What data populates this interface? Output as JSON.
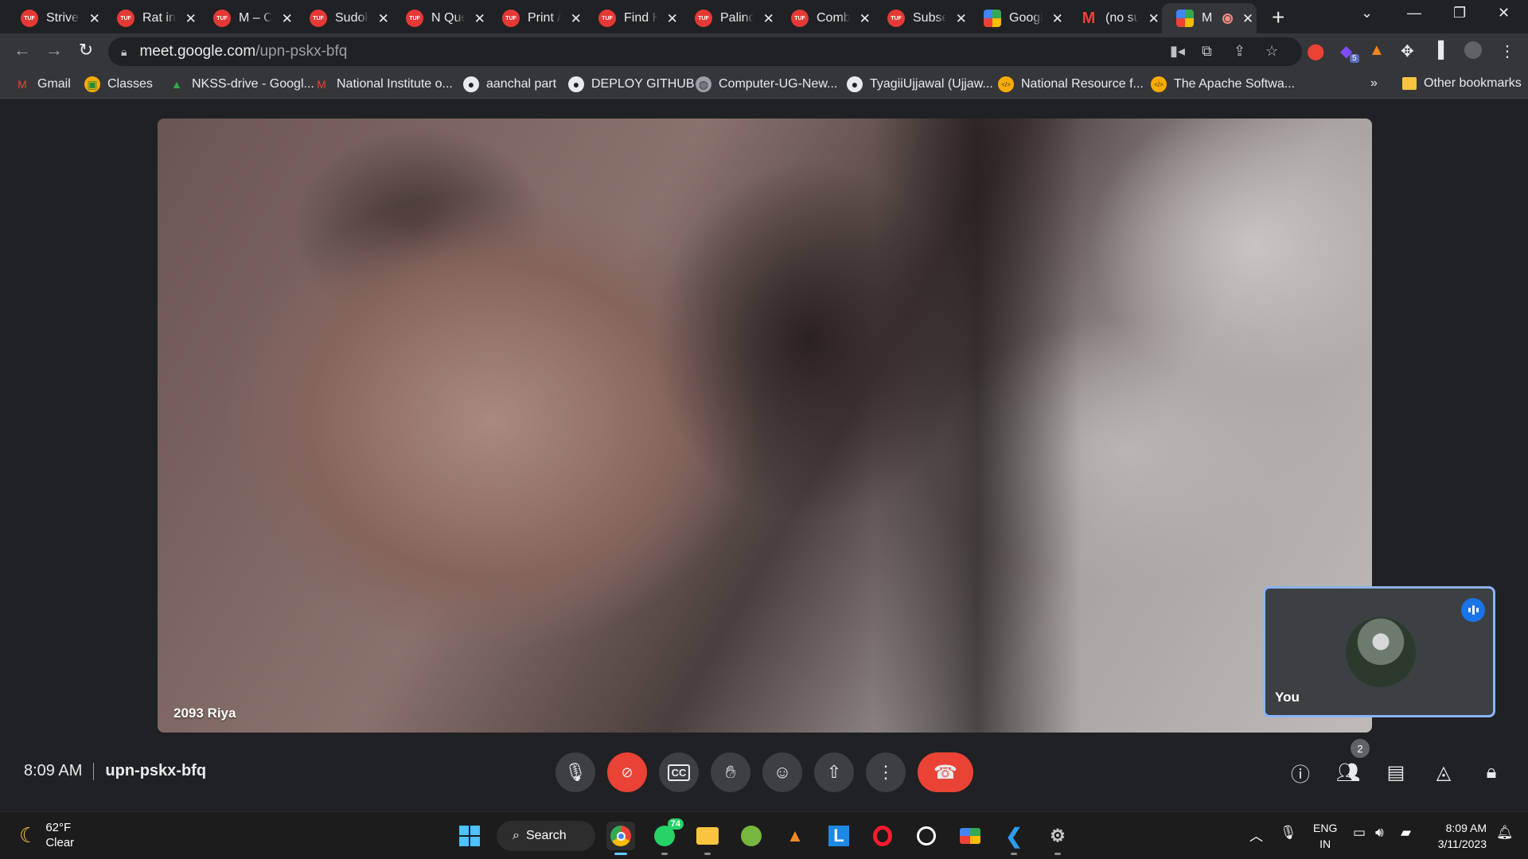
{
  "browser": {
    "tabs": [
      {
        "title": "Striver",
        "favicon": "tuf"
      },
      {
        "title": "Rat in",
        "favicon": "tuf"
      },
      {
        "title": "M – C",
        "favicon": "tuf"
      },
      {
        "title": "Sudok",
        "favicon": "tuf"
      },
      {
        "title": "N Que",
        "favicon": "tuf"
      },
      {
        "title": "Print /",
        "favicon": "tuf"
      },
      {
        "title": "Find K",
        "favicon": "tuf"
      },
      {
        "title": "Palind",
        "favicon": "tuf"
      },
      {
        "title": "Comb",
        "favicon": "tuf"
      },
      {
        "title": "Subse",
        "favicon": "tuf"
      },
      {
        "title": "Googl",
        "favicon": "meet"
      },
      {
        "title": "(no su",
        "favicon": "gmail"
      },
      {
        "title": "M",
        "favicon": "meet",
        "active": true,
        "recording": true
      }
    ],
    "favicon_text": {
      "tuf": "TUF",
      "gmail": "M"
    },
    "url_host": "meet.google.com",
    "url_path": "/upn-pskx-bfq",
    "bookmarks": [
      {
        "label": "Gmail",
        "icon": "gmail-icon"
      },
      {
        "label": "Classes",
        "icon": "classroom-icon"
      },
      {
        "label": "NKSS-drive - Googl...",
        "icon": "drive-icon"
      },
      {
        "label": "National Institute o...",
        "icon": "gmail-icon"
      },
      {
        "label": "aanchal part",
        "icon": "github-icon"
      },
      {
        "label": "DEPLOY GITHUB",
        "icon": "github-icon"
      },
      {
        "label": "Computer-UG-New...",
        "icon": "globe-icon"
      },
      {
        "label": "TyagiiUjjawal (Ujjaw...",
        "icon": "github-icon"
      },
      {
        "label": "National Resource f...",
        "icon": "code-icon"
      },
      {
        "label": "The Apache Softwa...",
        "icon": "code-icon"
      }
    ],
    "more_bookmarks": "»",
    "other_bookmarks": "Other bookmarks",
    "extension_badge": "5"
  },
  "meet": {
    "participant_name": "2093 Riya",
    "self_label": "You",
    "time": "8:09 AM",
    "meeting_code": "upn-pskx-bfq",
    "participant_count": "2"
  },
  "taskbar": {
    "weather_temp": "62°F",
    "weather_desc": "Clear",
    "search_label": "Search",
    "whatsapp_badge": "74",
    "lang_line1": "ENG",
    "lang_line2": "IN",
    "clock_time": "8:09 AM",
    "clock_date": "3/11/2023"
  },
  "colors": {
    "end_call": "#ea4335",
    "accent": "#8ab4f8",
    "tuf_red": "#e53935"
  }
}
